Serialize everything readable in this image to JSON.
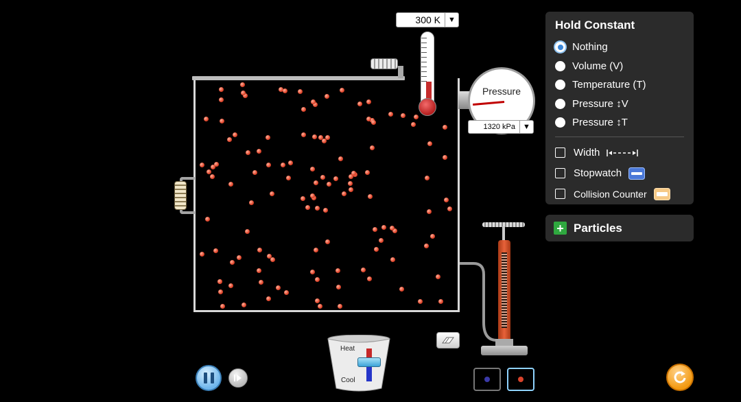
{
  "thermometer": {
    "value": "300 K",
    "fill_fraction": 0.32
  },
  "gauge": {
    "label": "Pressure",
    "value": "1320 kPa"
  },
  "heater": {
    "heat_label": "Heat",
    "cool_label": "Cool"
  },
  "hold_constant": {
    "title": "Hold Constant",
    "options": [
      {
        "label": "Nothing",
        "selected": true
      },
      {
        "label": "Volume (V)",
        "selected": false
      },
      {
        "label": "Temperature (T)",
        "selected": false
      },
      {
        "label": "Pressure ↕V",
        "selected": false
      },
      {
        "label": "Pressure ↕T",
        "selected": false
      }
    ]
  },
  "tools": [
    {
      "label": "Width",
      "checked": false,
      "icon": "width-arrows-icon"
    },
    {
      "label": "Stopwatch",
      "checked": false,
      "icon": "stopwatch-icon"
    },
    {
      "label": "Collision Counter",
      "checked": false,
      "icon": "collision-counter-icon"
    }
  ],
  "particles_panel": {
    "label": "Particles",
    "icon": "plus-icon"
  },
  "play_state": "playing",
  "particle_types": [
    {
      "name": "heavy",
      "color": "#3a39a8",
      "selected": false
    },
    {
      "name": "light",
      "color": "#d9432b",
      "selected": true
    }
  ],
  "colors": {
    "panel": "#2b2b2b",
    "accent": "#f39a12",
    "particle": "#e0442a"
  }
}
